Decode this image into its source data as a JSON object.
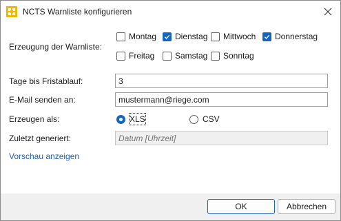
{
  "window": {
    "title": "NCTS Warnliste konfigurieren",
    "app_icon": "ncts-app-icon",
    "close_icon": "close-icon"
  },
  "colors": {
    "accent": "#1565c0",
    "link": "#1f5fbf",
    "footer_bg": "#f0f0f0"
  },
  "form": {
    "erzeugung_label": "Erzeugung der Warnliste:",
    "weekdays": [
      {
        "label": "Montag",
        "checked": false
      },
      {
        "label": "Dienstag",
        "checked": true
      },
      {
        "label": "Mittwoch",
        "checked": false
      },
      {
        "label": "Donnerstag",
        "checked": true
      },
      {
        "label": "Freitag",
        "checked": false
      },
      {
        "label": "Samstag",
        "checked": false
      },
      {
        "label": "Sonntag",
        "checked": false
      }
    ],
    "tage_label": "Tage bis Fristablauf:",
    "tage_value": "3",
    "email_label": "E-Mail senden an:",
    "email_value": "mustermann@riege.com",
    "erzeugen_label": "Erzeugen als:",
    "formats": [
      {
        "label": "XLS",
        "selected": true
      },
      {
        "label": "CSV",
        "selected": false
      }
    ],
    "zuletzt_label": "Zuletzt generiert:",
    "zuletzt_placeholder": "Datum [Uhrzeit]"
  },
  "preview_link": "Vorschau anzeigen",
  "footer": {
    "ok_label": "OK",
    "cancel_label": "Abbrechen"
  }
}
